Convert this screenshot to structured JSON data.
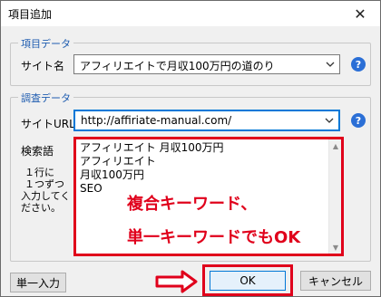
{
  "window": {
    "title": "項目追加",
    "close_glyph": "✕"
  },
  "item_group": {
    "legend": "項目データ",
    "site_name_label": "サイト名",
    "site_name_value": "アフィリエイトで月収100万円の道のり"
  },
  "research_group": {
    "legend": "調査データ",
    "site_url_label": "サイトURL",
    "site_url_value": "http://affiriate-manual.com/",
    "keywords_label": "検索語",
    "keywords_note": [
      "１行に",
      "１つずつ",
      "入力してく",
      "ださい。"
    ],
    "keywords": [
      "アフィリエイト 月収100万円",
      "アフィリエイト",
      "月収100万円",
      "SEO"
    ]
  },
  "annotation": {
    "line1": "複合キーワード、",
    "line2": "単一キーワードでもOK",
    "color": "#e0001b"
  },
  "buttons": {
    "single_input": "単一入力",
    "ok": "OK",
    "cancel": "キャンセル"
  },
  "icons": {
    "help": "?",
    "dropdown": "chevron-down-icon"
  }
}
